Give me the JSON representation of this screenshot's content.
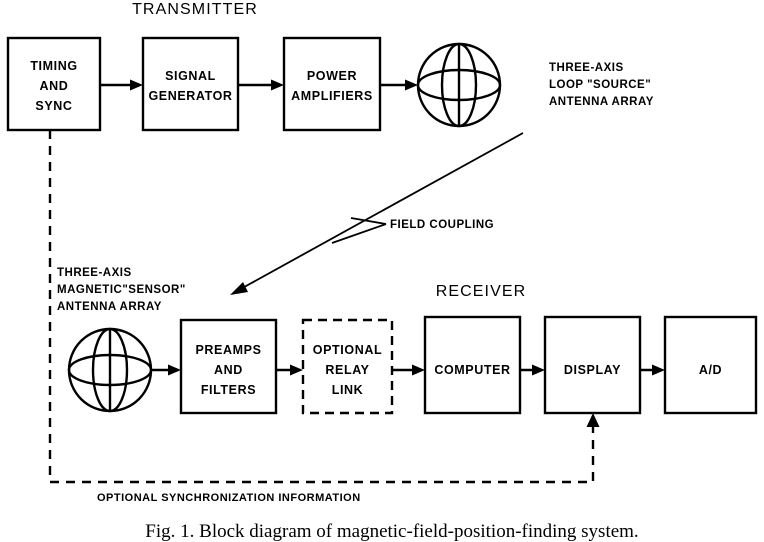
{
  "figure": {
    "caption": "Fig. 1.  Block diagram of magnetic-field-position-finding system."
  },
  "sections": {
    "transmitter_heading": "TRANSMITTER",
    "receiver_heading": "RECEIVER"
  },
  "transmitter": {
    "blocks": [
      {
        "id": "timing-and-sync",
        "lines": [
          "TIMING",
          "AND",
          "SYNC"
        ],
        "style": "solid"
      },
      {
        "id": "signal-generator",
        "lines": [
          "SIGNAL",
          "GENERATOR"
        ],
        "style": "solid"
      },
      {
        "id": "power-amplifiers",
        "lines": [
          "POWER",
          "AMPLIFIERS"
        ],
        "style": "solid"
      }
    ],
    "antenna": {
      "id": "source-antenna-sphere",
      "label_lines": [
        "THREE-AXIS",
        "LOOP \"SOURCE\"",
        "ANTENNA ARRAY"
      ]
    }
  },
  "receiver": {
    "antenna": {
      "id": "sensor-antenna-sphere",
      "label_lines": [
        "THREE-AXIS",
        "MAGNETIC\"SENSOR\"",
        "ANTENNA ARRAY"
      ]
    },
    "blocks": [
      {
        "id": "preamps-and-filters",
        "lines": [
          "PREAMPS",
          "AND",
          "FILTERS"
        ],
        "style": "solid"
      },
      {
        "id": "optional-relay-link",
        "lines": [
          "OPTIONAL",
          "RELAY",
          "LINK"
        ],
        "style": "dashed"
      },
      {
        "id": "computer",
        "lines": [
          "COMPUTER"
        ],
        "style": "solid"
      },
      {
        "id": "display",
        "lines": [
          "DISPLAY"
        ],
        "style": "solid"
      },
      {
        "id": "analog-to-digital",
        "lines": [
          "A/D"
        ],
        "style": "solid"
      }
    ]
  },
  "annotations": {
    "field_coupling": "FIELD COUPLING",
    "optional_sync": "OPTIONAL  SYNCHRONIZATION  INFORMATION"
  },
  "colors": {
    "ink": "#000000",
    "paper": "#ffffff"
  }
}
